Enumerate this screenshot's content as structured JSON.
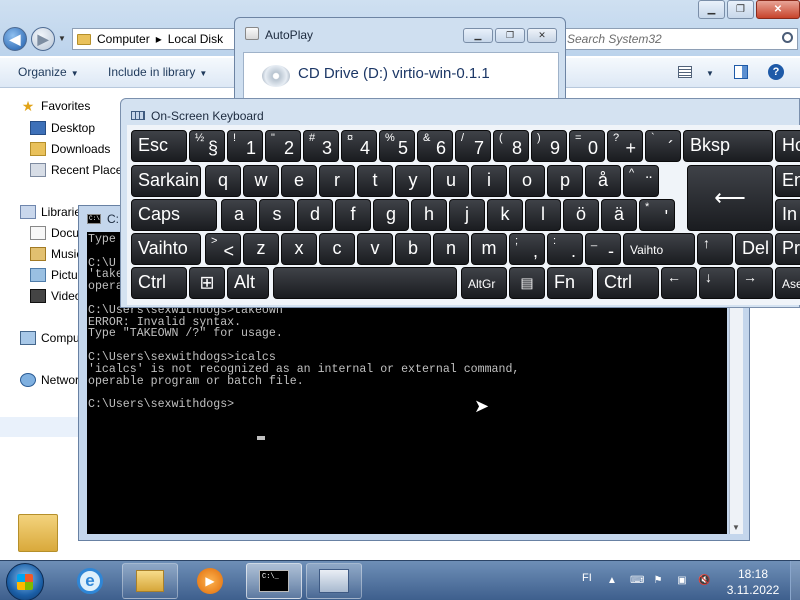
{
  "explorer": {
    "breadcrumb": [
      "Computer",
      "Local Disk"
    ],
    "search_placeholder": "Search System32",
    "toolbar": {
      "organize": "Organize",
      "include": "Include in library"
    },
    "nav": {
      "favorites": "Favorites",
      "desktop": "Desktop",
      "downloads": "Downloads",
      "recent": "Recent Places",
      "libraries": "Libraries",
      "documents": "Documents",
      "music": "Music",
      "pictures": "Pictures",
      "videos": "Videos",
      "computer": "Computer",
      "network": "Network"
    },
    "window_buttons": {
      "minimize": "▁",
      "maximize": "❐",
      "close": "✕"
    }
  },
  "autoplay": {
    "title": "AutoPlay",
    "drive": "CD Drive (D:) virtio-win-0.1.1"
  },
  "osk": {
    "title": "On-Screen Keyboard",
    "row1": {
      "esc": "Esc",
      "k1": {
        "top": "½",
        "main": "§"
      },
      "k2": {
        "top": "!",
        "main": "1"
      },
      "k3": {
        "top": "\"",
        "main": "2"
      },
      "k4": {
        "top": "#",
        "main": "3"
      },
      "k5": {
        "top": "¤",
        "main": "4"
      },
      "k6": {
        "top": "%",
        "main": "5"
      },
      "k7": {
        "top": "&",
        "main": "6"
      },
      "k8": {
        "top": "/",
        "main": "7"
      },
      "k9": {
        "top": "(",
        "main": "8"
      },
      "k10": {
        "top": ")",
        "main": "9"
      },
      "k11": {
        "top": "=",
        "main": "0"
      },
      "k12": {
        "top": "?",
        "main": "+"
      },
      "k13": {
        "top": "`",
        "main": "´"
      },
      "bksp": "Bksp",
      "end": "Ho"
    },
    "row2": {
      "caps_lock": "Sarkain",
      "letters": [
        "q",
        "w",
        "e",
        "r",
        "t",
        "y",
        "u",
        "i",
        "o",
        "p",
        "å"
      ],
      "k12": {
        "top": "^",
        "main": "¨"
      },
      "enter": "⟵",
      "end": "En"
    },
    "row3": {
      "caps": "Caps",
      "letters": [
        "a",
        "s",
        "d",
        "f",
        "g",
        "h",
        "j",
        "k",
        "l",
        "ö",
        "ä"
      ],
      "k12": {
        "top": "*",
        "main": "'"
      },
      "end": "In"
    },
    "row4": {
      "shift": "Vaihto",
      "k1": {
        "top": ">",
        "main": "<"
      },
      "letters": [
        "z",
        "x",
        "c",
        "v",
        "b",
        "n",
        "m"
      ],
      "k8": {
        "top": ";",
        "main": ","
      },
      "k9": {
        "top": ":",
        "main": "."
      },
      "k10": {
        "top": "_",
        "main": "-"
      },
      "shift_right": "Vaihto",
      "up": "↑",
      "del": "Del",
      "end": "Pr"
    },
    "row5": {
      "ctrl": "Ctrl",
      "win": "⊞",
      "alt": "Alt",
      "altgr": "AltGr",
      "menu": "▤",
      "fn": "Fn",
      "ctrl_right": "Ctrl",
      "left": "←",
      "down": "↓",
      "right": "→",
      "end": "Ase"
    }
  },
  "cmd": {
    "title": "C:",
    "console_lines": [
      "Type \"TAKEOWN /?\" for usage.",
      "",
      "C:\\U",
      "'take",
      "opera",
      "",
      "C:\\Users\\sexwithdogs>takeown",
      "ERROR: Invalid syntax.",
      "Type \"TAKEOWN /?\" for usage.",
      "",
      "C:\\Users\\sexwithdogs>icalcs",
      "'icalcs' is not recognized as an internal or external command,",
      "operable program or batch file.",
      "",
      "C:\\Users\\sexwithdogs>"
    ]
  },
  "taskbar": {
    "language": "FI",
    "time": "18:18",
    "date": "3.11.2022",
    "icons": [
      "start-orb",
      "internet-explorer-icon",
      "explorer-icon",
      "media-player-icon",
      "cmd-icon",
      "osk-icon"
    ]
  }
}
